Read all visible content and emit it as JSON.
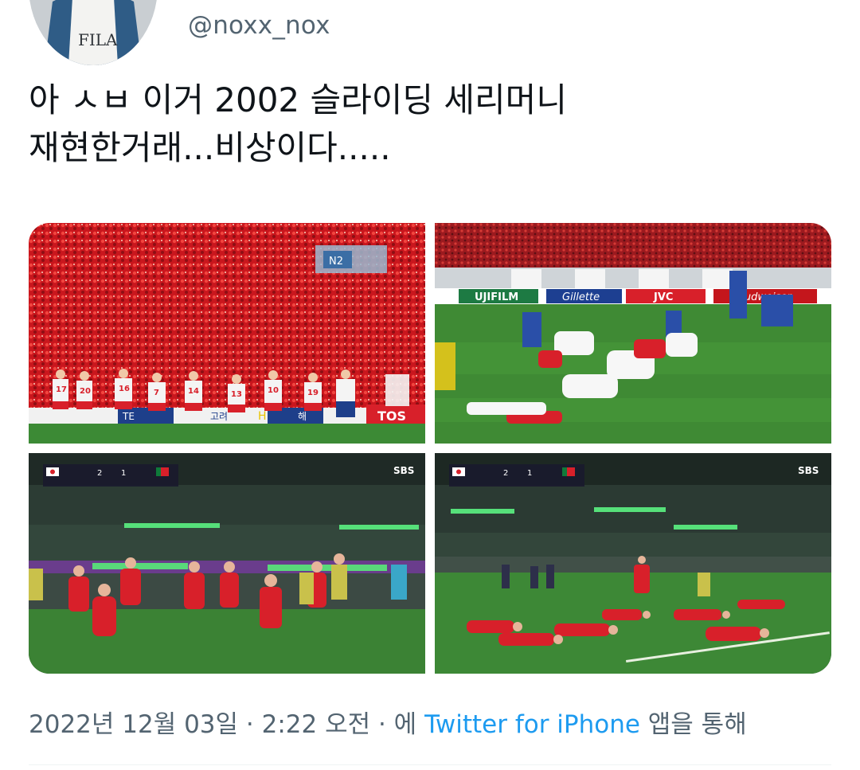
{
  "user": {
    "handle": "@noxx_nox",
    "avatar_shirt_text": "FILA"
  },
  "tweet": {
    "text": "아 ㅅㅂ 이거 2002 슬라이딩 세리머니\n재현한거래...비상이다....."
  },
  "photos": [
    {
      "id": "photo-1",
      "signs": [
        "TE",
        "고려",
        "H",
        "해",
        "TOS"
      ],
      "gate_sign": "N2",
      "shirt_numbers": [
        "17",
        "20",
        "16",
        "7",
        "14",
        "13",
        "10",
        "19"
      ]
    },
    {
      "id": "photo-2",
      "boards": [
        "UJIFILM",
        "Gillette",
        "JVC",
        "Budweiser"
      ]
    },
    {
      "id": "photo-3",
      "broadcaster": "SBS",
      "score_home": "2",
      "score_away": "1"
    },
    {
      "id": "photo-4",
      "broadcaster": "SBS",
      "score_home": "2",
      "score_away": "1"
    }
  ],
  "meta": {
    "timestamp": "2022년 12월 03일 · 2:22 오전 · 에 ",
    "source": "Twitter for iPhone",
    "suffix": " 앱을 통해"
  },
  "colors": {
    "link": "#1d9bf0",
    "secondary_text": "#536471",
    "primary_text": "#0f1419",
    "korea_red": "#d8202a",
    "pitch_green": "#3f8a34"
  }
}
